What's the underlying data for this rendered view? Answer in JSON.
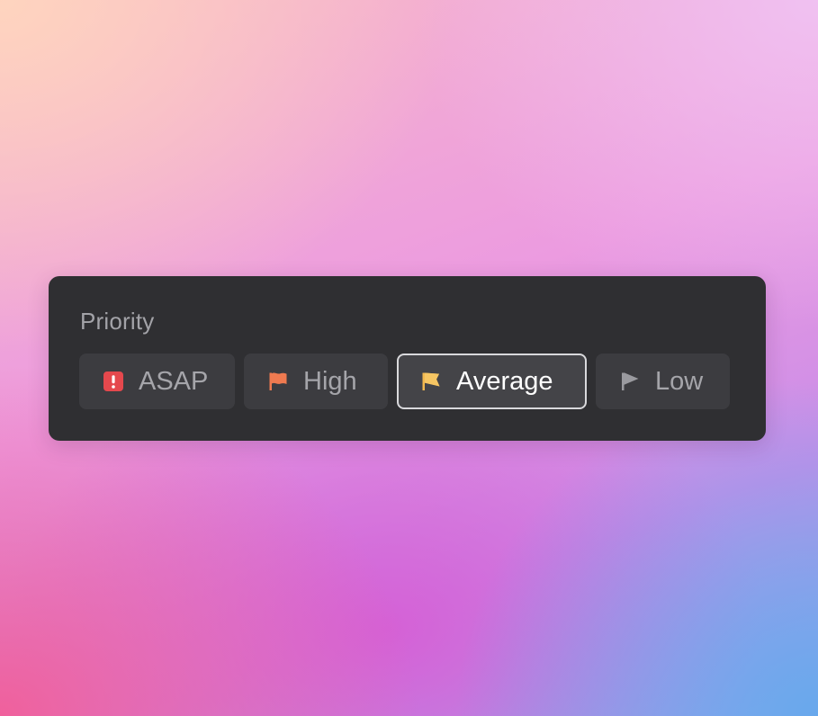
{
  "priority_panel": {
    "title": "Priority",
    "selected": "Average",
    "options": [
      {
        "label": "ASAP",
        "icon": "exclamation-square-icon",
        "icon_color": "#e5484d",
        "selected": false
      },
      {
        "label": "High",
        "icon": "flag-icon",
        "icon_color": "#ef7a50",
        "selected": false
      },
      {
        "label": "Average",
        "icon": "flag-icon",
        "icon_color": "#f2b94f",
        "selected": true
      },
      {
        "label": "Low",
        "icon": "flag-icon",
        "icon_color": "#9a9a9f",
        "selected": false
      }
    ]
  },
  "colors": {
    "panel_background": "#2f2f32",
    "option_background": "#3c3c40",
    "selected_border": "#d9d9dc",
    "label_text": "#a5a5aa",
    "selected_text": "#ffffff"
  }
}
